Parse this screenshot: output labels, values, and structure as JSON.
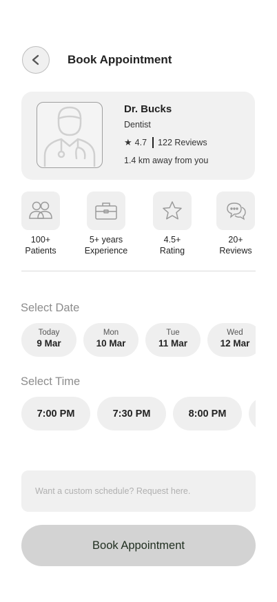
{
  "header": {
    "title": "Book Appointment",
    "back_icon": "chevron-left-icon"
  },
  "doctor": {
    "name": "Dr. Bucks",
    "specialty": "Dentist",
    "rating": "4.7",
    "reviews": "122 Reviews",
    "distance": "1.4 km away from you",
    "photo_icon": "doctor-placeholder-icon"
  },
  "stats": [
    {
      "icon": "patients-icon",
      "line1": "100+",
      "line2": "Patients"
    },
    {
      "icon": "briefcase-icon",
      "line1": "5+ years",
      "line2": "Experience"
    },
    {
      "icon": "star-outline-icon",
      "line1": "4.5+",
      "line2": "Rating"
    },
    {
      "icon": "chat-bubble-icon",
      "line1": "20+",
      "line2": "Reviews"
    }
  ],
  "date_section": {
    "label": "Select Date",
    "dates": [
      {
        "day": "Today",
        "date": "9 Mar"
      },
      {
        "day": "Mon",
        "date": "10 Mar"
      },
      {
        "day": "Tue",
        "date": "11 Mar"
      },
      {
        "day": "Wed",
        "date": "12 Mar"
      }
    ]
  },
  "time_section": {
    "label": "Select Time",
    "times": [
      "7:00 PM",
      "7:30 PM",
      "8:00 PM",
      ""
    ]
  },
  "request": {
    "placeholder": "Want a custom schedule? Request here.",
    "value": ""
  },
  "book_button": {
    "label": "Book Appointment"
  },
  "colors": {
    "card_bg": "#f1f1f1",
    "chip_bg": "#efefef",
    "button_bg": "#d3d3d3",
    "muted_text": "#8c8c8c"
  }
}
